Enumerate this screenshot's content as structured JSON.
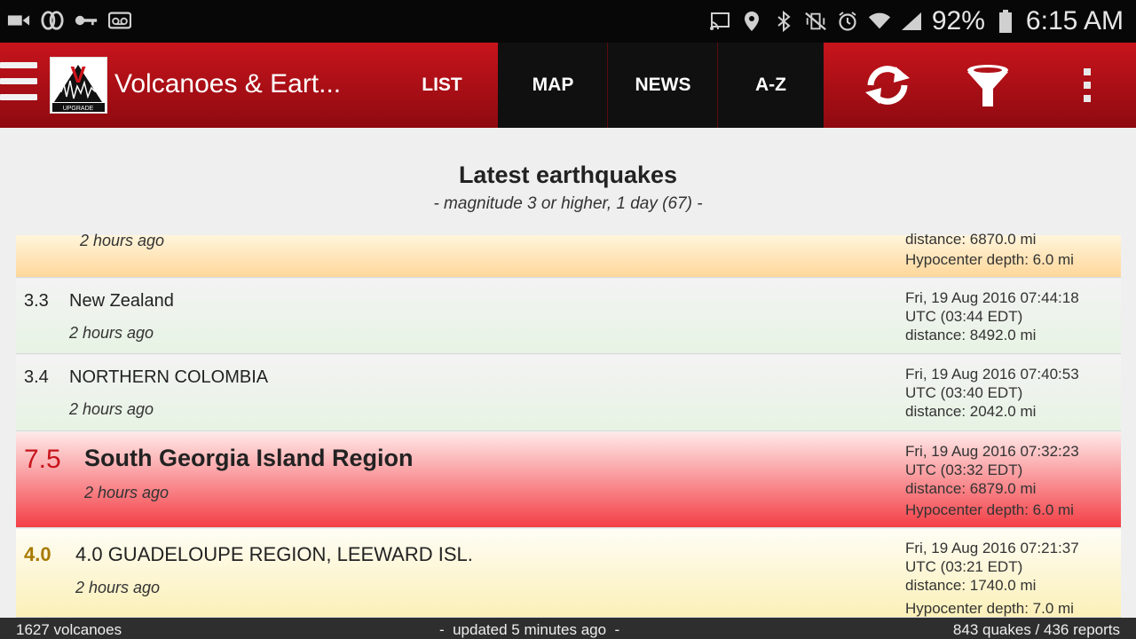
{
  "status_bar": {
    "left_icons": [
      "video-camera-icon",
      "voicemail-loop-icon",
      "key-icon",
      "voicemail-icon"
    ],
    "right_icons": [
      "cast-icon",
      "location-pin-icon",
      "bluetooth-icon",
      "vibrate-mute-icon",
      "alarm-icon",
      "wifi-icon",
      "cell-signal-icon"
    ],
    "battery": "92%",
    "time": "6:15 AM"
  },
  "app_bar": {
    "title": "Volcanoes & Eart...",
    "logo_letter": "V",
    "logo_badge": "UPGRADE",
    "tabs": [
      {
        "label": "LIST",
        "active": false
      },
      {
        "label": "MAP",
        "active": true
      },
      {
        "label": "NEWS",
        "active": true
      },
      {
        "label": "A-Z",
        "active": true
      }
    ],
    "actions": [
      "refresh-icon",
      "filter-icon",
      "overflow-menu-icon"
    ]
  },
  "list": {
    "heading": "Latest earthquakes",
    "subheading": "- magnitude 3 or higher, 1 day (67) -",
    "rows": [
      {
        "mag": "",
        "place": "",
        "ago": "2 hours ago",
        "date": "",
        "utc": "",
        "distance": "distance: 6870.0 mi",
        "depth": "Hypocenter depth: 6.0 mi"
      },
      {
        "mag": "3.3",
        "place": "New Zealand",
        "ago": "2 hours ago",
        "date": "Fri, 19 Aug 2016 07:44:18",
        "utc": "UTC (03:44 EDT)",
        "distance": "distance: 8492.0 mi",
        "depth": ""
      },
      {
        "mag": "3.4",
        "place": "NORTHERN COLOMBIA",
        "ago": "2 hours ago",
        "date": "Fri, 19 Aug 2016 07:40:53",
        "utc": "UTC (03:40 EDT)",
        "distance": "distance: 2042.0 mi",
        "depth": ""
      },
      {
        "mag": "7.5",
        "place": "South Georgia Island Region",
        "ago": "2 hours ago",
        "date": "Fri, 19 Aug 2016 07:32:23",
        "utc": "UTC (03:32 EDT)",
        "distance": "distance: 6879.0 mi",
        "depth": "Hypocenter depth: 6.0 mi"
      },
      {
        "mag": "4.0",
        "place": "4.0 GUADELOUPE REGION, LEEWARD ISL.",
        "ago": "2 hours ago",
        "date": "Fri, 19 Aug 2016 07:21:37",
        "utc": "UTC (03:21 EDT)",
        "distance": "distance: 1740.0 mi",
        "depth": "Hypocenter depth: 7.0 mi"
      }
    ]
  },
  "footer": {
    "volcanoes": "1627 volcanoes",
    "updated": "-  updated 5 minutes ago  -",
    "quakes": "843 quakes / 436 reports"
  },
  "colors": {
    "appbar_red": "#b0121a",
    "tab_dark": "#101010",
    "major_quake_text": "#c8141c",
    "moderate_quake_text": "#a87a00"
  }
}
